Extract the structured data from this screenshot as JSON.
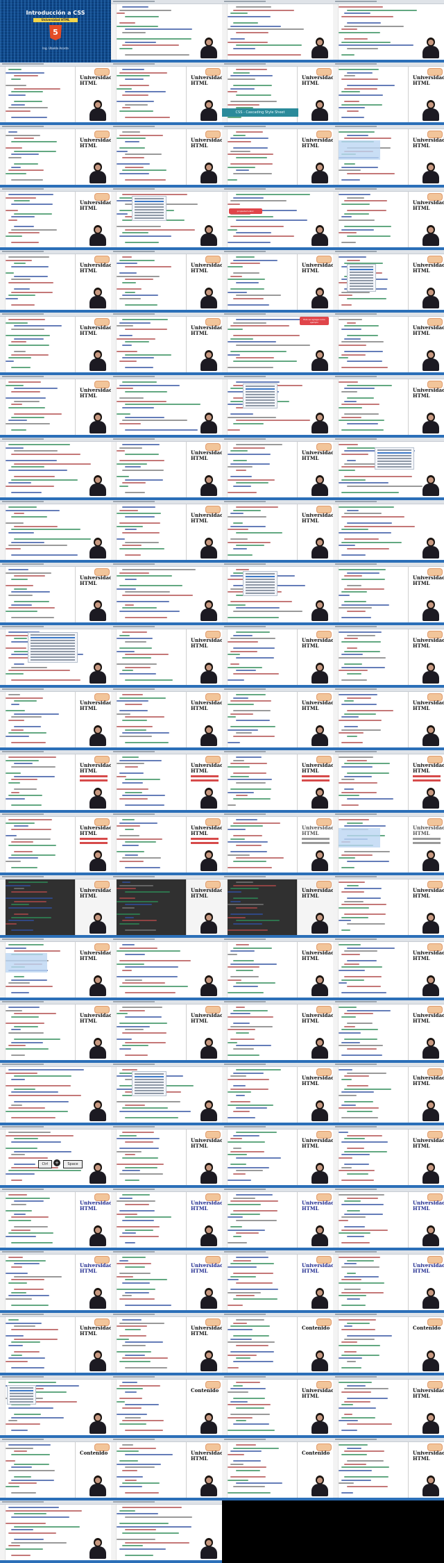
{
  "title_slide": {
    "heading": "Introducción a CSS",
    "subheading": "Universidad HTML",
    "shield_glyph": "5",
    "author": "Ing. Ubaldo Acosta"
  },
  "preview_titles": {
    "universidad": "Universidad",
    "html": "HTML",
    "universidad_html": "Universidad HTML",
    "contenido": "Contenido"
  },
  "overlays": {
    "css_banner": "CSS - Cascading Style Sheet",
    "bubble_red_1": "propiedad:valor;",
    "bubble_red_2": "Esto se agrega como ejemplo",
    "key_ctrl": "Ctrl",
    "key_plus": "+",
    "key_space": "Space"
  },
  "colors": {
    "accent_blue": "#2b6fb8",
    "tag_red": "#b04a4a",
    "attr_green": "#2e8b57",
    "heading_red": "#d64a4a",
    "callout_red": "#e0454a"
  },
  "icons": {
    "presenter": "presenter-thumbnail",
    "logo": "universidad-logo"
  }
}
